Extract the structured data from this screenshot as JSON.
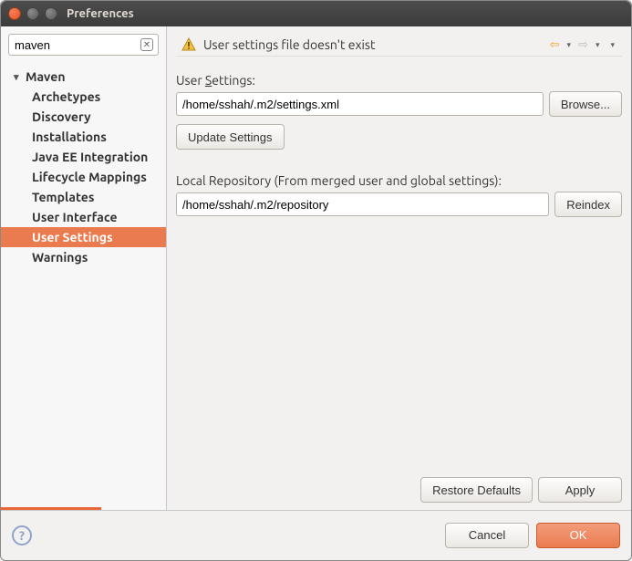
{
  "window": {
    "title": "Preferences"
  },
  "sidebar": {
    "search_value": "maven",
    "root_label": "Maven",
    "items": [
      {
        "label": "Archetypes"
      },
      {
        "label": "Discovery"
      },
      {
        "label": "Installations"
      },
      {
        "label": "Java EE Integration"
      },
      {
        "label": "Lifecycle Mappings"
      },
      {
        "label": "Templates"
      },
      {
        "label": "User Interface"
      },
      {
        "label": "User Settings"
      },
      {
        "label": "Warnings"
      }
    ]
  },
  "banner": {
    "message": "User settings file doesn't exist"
  },
  "form": {
    "user_settings_label_pre": "User ",
    "user_settings_label_mn": "S",
    "user_settings_label_post": "ettings:",
    "user_settings_value": "/home/sshah/.m2/settings.xml",
    "browse_label": "Browse...",
    "update_label": "Update Settings",
    "local_repo_label": "Local Repository (From merged user and global settings):",
    "local_repo_value": "/home/sshah/.m2/repository",
    "reindex_label": "Reindex"
  },
  "actions": {
    "restore_defaults": "Restore Defaults",
    "apply": "Apply",
    "cancel": "Cancel",
    "ok": "OK"
  }
}
